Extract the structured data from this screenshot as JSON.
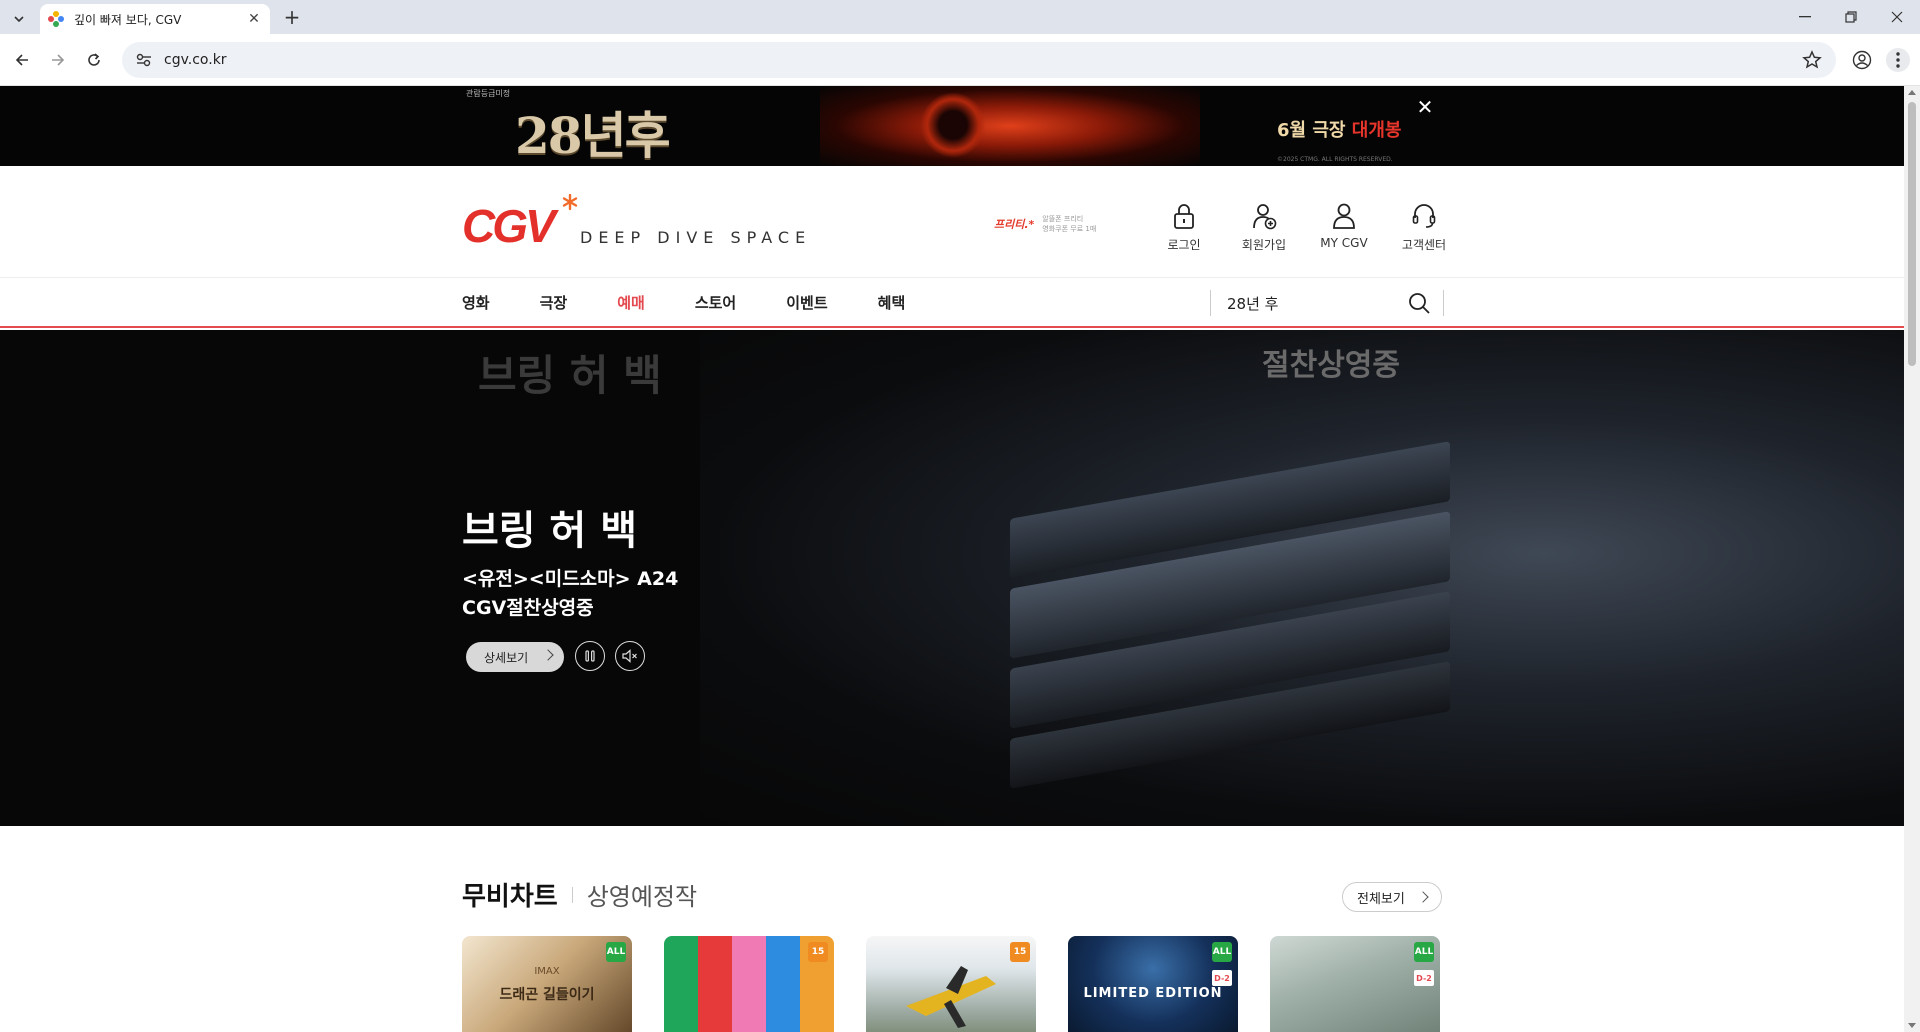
{
  "browser": {
    "tab_title": "깊이 빠져 보다, CGV",
    "url": "cgv.co.kr"
  },
  "top_banner": {
    "rating": "관람등급미정",
    "movie_title": "28년후",
    "promo_prefix": "6월 극장",
    "promo_highlight": "대개봉",
    "copyright": "©2025 CTMG. ALL RIGHTS RESERVED."
  },
  "header": {
    "tagline": "DEEP DIVE SPACE",
    "partner_logo": "프리티.*",
    "partner_line1": "알뜰폰 프리티",
    "partner_line2": "영화쿠폰 무료 1매",
    "utils": [
      "로그인",
      "회원가입",
      "MY CGV",
      "고객센터"
    ]
  },
  "gnb": {
    "menu": [
      "영화",
      "극장",
      "예매",
      "스토어",
      "이벤트",
      "혜택"
    ],
    "active_index": 2,
    "search_value": "28년 후"
  },
  "hero": {
    "ghost_title": "브링 허 백",
    "ghost_badge": "절찬상영중",
    "title": "브링 허 백",
    "sub_line1": "<유전><미드소마> A24",
    "sub_line2": "CGV절찬상영중",
    "detail_button": "상세보기"
  },
  "movie_chart": {
    "tab_active": "무비차트",
    "tab_inactive": "상영예정작",
    "view_all": "전체보기",
    "posters": [
      {
        "badge": "ALL",
        "badge_color": "#27a844",
        "dday": "",
        "text": "드래곤 길들이기"
      },
      {
        "badge": "15",
        "badge_color": "#ef8b21",
        "dday": "",
        "text": ""
      },
      {
        "badge": "15",
        "badge_color": "#ef8b21",
        "dday": "",
        "text": ""
      },
      {
        "badge": "ALL",
        "badge_color": "#27a844",
        "dday": "D-2",
        "text": "LIMITED EDITION"
      },
      {
        "badge": "ALL",
        "badge_color": "#27a844",
        "dday": "D-2",
        "text": ""
      }
    ]
  },
  "colors": {
    "brand_red": "#e3494f",
    "rating_all": "#27a844",
    "rating_15": "#ef8b21"
  }
}
